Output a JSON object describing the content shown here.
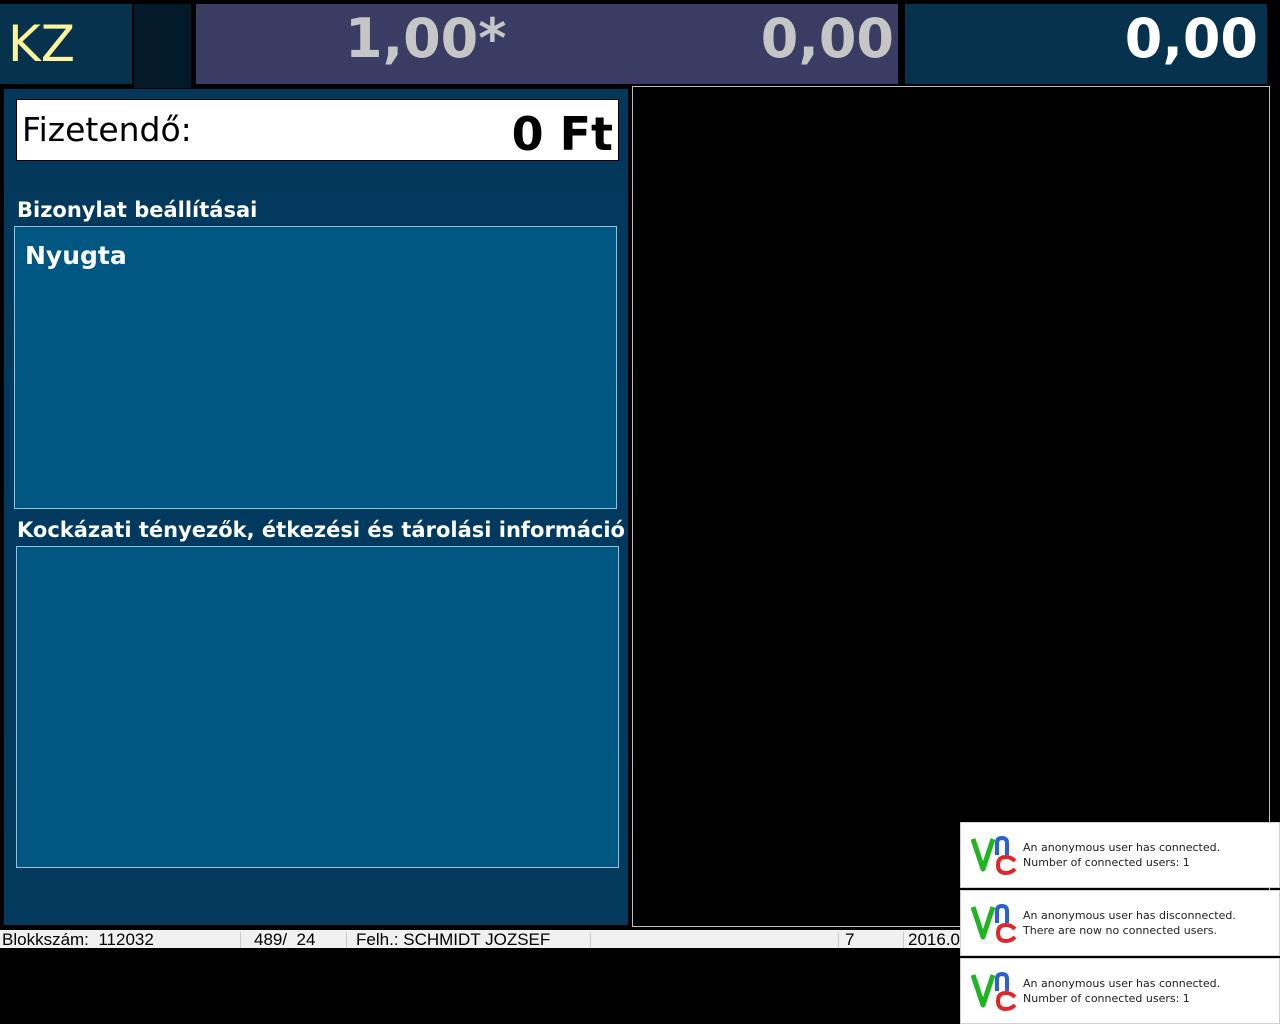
{
  "top_bar": {
    "mode_label": "KZ",
    "quantity": "1,00*",
    "unit_price": "0,00",
    "line_total": "0,00"
  },
  "payment": {
    "label": "Fizetendő:",
    "amount": "0 Ft"
  },
  "receipt_settings": {
    "title": "Bizonylat beállításai",
    "receipt_type": "Nyugta"
  },
  "risk_info": {
    "title": "Kockázati tényezők, étkezési és tárolási információ"
  },
  "status_bar": {
    "block_number": "Blokkszám:  112032",
    "counter": "489/  24",
    "user": "Felh.: SCHMIDT JOZSEF",
    "field_4": "7",
    "date": "2016.0"
  },
  "notifications": [
    {
      "line1": "An anonymous user has connected.",
      "line2": "Number of connected users: 1"
    },
    {
      "line1": "An anonymous user has disconnected.",
      "line2": "There are now no connected users."
    },
    {
      "line1": "An anonymous user has connected.",
      "line2": "Number of connected users: 1"
    }
  ],
  "colors": {
    "top_panel": "#06324d",
    "quantity_panel": "#3a3c64",
    "mode_text": "#fbf49c",
    "info_box": "#005882",
    "vnc_green": "#1fb51f",
    "vnc_blue": "#2a5fd6",
    "vnc_red": "#e0262b"
  },
  "icons": {
    "vnc_logo": "vnc-logo-icon"
  }
}
